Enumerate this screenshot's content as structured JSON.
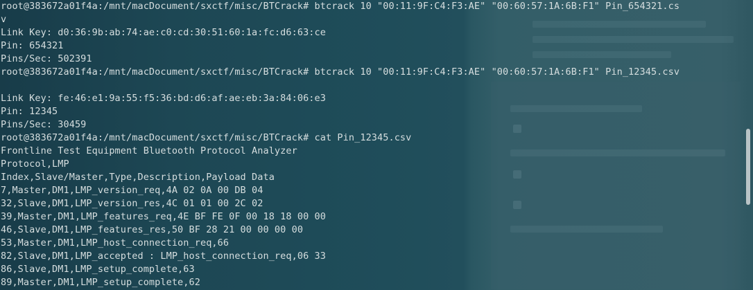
{
  "terminal": {
    "lines": [
      "root@383672a01f4a:/mnt/macDocument/sxctf/misc/BTCrack# btcrack 10 \"00:11:9F:C4:F3:AE\" \"00:60:57:1A:6B:F1\" Pin_654321.cs",
      "v",
      "Link Key: d0:36:9b:ab:74:ae:c0:cd:30:51:60:1a:fc:d6:63:ce",
      "Pin: 654321",
      "Pins/Sec: 502391",
      "root@383672a01f4a:/mnt/macDocument/sxctf/misc/BTCrack# btcrack 10 \"00:11:9F:C4:F3:AE\" \"00:60:57:1A:6B:F1\" Pin_12345.csv",
      "",
      "Link Key: fe:46:e1:9a:55:f5:36:bd:d6:af:ae:eb:3a:84:06:e3",
      "Pin: 12345",
      "Pins/Sec: 30459",
      "root@383672a01f4a:/mnt/macDocument/sxctf/misc/BTCrack# cat Pin_12345.csv",
      "Frontline Test Equipment Bluetooth Protocol Analyzer",
      "Protocol,LMP",
      "Index,Slave/Master,Type,Description,Payload Data",
      "7,Master,DM1,LMP_version_req,4A 02 0A 00 DB 04",
      "32,Slave,DM1,LMP_version_res,4C 01 01 00 2C 02",
      "39,Master,DM1,LMP_features_req,4E BF FE 0F 00 18 18 00 00",
      "46,Slave,DM1,LMP_features_res,50 BF 28 21 00 00 00 00",
      "53,Master,DM1,LMP_host_connection_req,66",
      "82,Slave,DM1,LMP_accepted : LMP_host_connection_req,06 33",
      "86,Slave,DM1,LMP_setup_complete,63",
      "89,Master,DM1,LMP_setup_complete,62"
    ]
  },
  "colors": {
    "text": "#d6dedf",
    "background": "#1c4654"
  }
}
